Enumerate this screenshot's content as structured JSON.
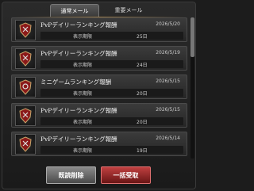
{
  "tabs": [
    {
      "label": "通常メール",
      "active": true
    },
    {
      "label": "重要メール",
      "active": false
    }
  ],
  "mails": [
    {
      "title": "PvPデイリーランキング報酬",
      "date": "2026/5/20",
      "period_label": "表示期限",
      "period_value": "25日"
    },
    {
      "title": "PvPデイリーランキング報酬",
      "date": "2026/5/19",
      "period_label": "表示期限",
      "period_value": "24日"
    },
    {
      "title": "ミニゲームランキング報酬",
      "date": "2026/5/15",
      "period_label": "表示期限",
      "period_value": "20日"
    },
    {
      "title": "PvPデイリーランキング報酬",
      "date": "2026/5/15",
      "period_label": "表示期限",
      "period_value": "20日"
    },
    {
      "title": "PvPデイリーランキング報酬",
      "date": "2026/5/14",
      "period_label": "表示期限",
      "period_value": "19日"
    }
  ],
  "buttons": {
    "delete_read": "既読削除",
    "receive_all": "一括受取"
  },
  "colors": {
    "accent_red": "#8b1a1a",
    "gold": "#9a7b4a"
  }
}
